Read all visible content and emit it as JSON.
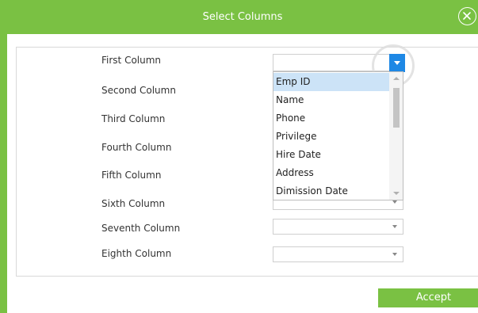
{
  "dialog": {
    "title": "Select Columns",
    "accent_color": "#7ac143",
    "close_icon": "close-circle-icon",
    "accept_label": "Accept"
  },
  "rows": [
    {
      "label": "First Column",
      "value": ""
    },
    {
      "label": "Second Column",
      "value": ""
    },
    {
      "label": "Third Column",
      "value": ""
    },
    {
      "label": "Fourth Column",
      "value": ""
    },
    {
      "label": "Fifth Column",
      "value": ""
    },
    {
      "label": "Sixth Column",
      "value": ""
    },
    {
      "label": "Seventh Column",
      "value": ""
    },
    {
      "label": "Eighth Column",
      "value": ""
    }
  ],
  "dropdown": {
    "open_for": "First Column",
    "selected": "Emp ID",
    "options": [
      "Emp ID",
      "Name",
      "Phone",
      "Privilege",
      "Hire Date",
      "Address",
      "Dimission Date"
    ],
    "button_color": "#1e88e5",
    "highlight_color": "#cce3f7"
  }
}
